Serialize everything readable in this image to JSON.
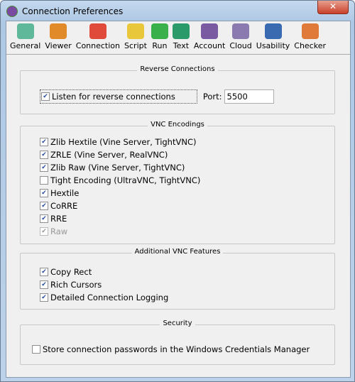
{
  "window": {
    "title": "Connection Preferences",
    "close_label": "✕"
  },
  "toolbar": [
    {
      "label": "General",
      "icon": "toolbox-icon",
      "color": "#5fb89a"
    },
    {
      "label": "Viewer",
      "icon": "glasses-icon",
      "color": "#e08a2a"
    },
    {
      "label": "Connection",
      "icon": "chain-link-icon",
      "color": "#e04a3a"
    },
    {
      "label": "Script",
      "icon": "pencil-gear-icon",
      "color": "#e8c83a"
    },
    {
      "label": "Run",
      "icon": "play-gear-icon",
      "color": "#3ab04a"
    },
    {
      "label": "Text",
      "icon": "magnifier-text-icon",
      "color": "#2a9a6a"
    },
    {
      "label": "Account",
      "icon": "user-gear-icon",
      "color": "#7a5aa0"
    },
    {
      "label": "Cloud",
      "icon": "cloud-icon",
      "color": "#8a7ab0"
    },
    {
      "label": "Usability",
      "icon": "eye-icon",
      "color": "#3a6ab0"
    },
    {
      "label": "Checker",
      "icon": "chart-magnifier-icon",
      "color": "#e07a3a"
    }
  ],
  "reverse": {
    "title": "Reverse Connections",
    "listen_label": "Listen for reverse connections",
    "listen_checked": true,
    "port_label": "Port:",
    "port_value": "5500"
  },
  "encodings": {
    "title": "VNC Encodings",
    "items": [
      {
        "label": "Zlib Hextile (Vine Server, TightVNC)",
        "checked": true
      },
      {
        "label": "ZRLE (Vine Server, RealVNC)",
        "checked": true
      },
      {
        "label": "Zlib Raw (Vine Server, TightVNC)",
        "checked": true
      },
      {
        "label": "Tight Encoding (UltraVNC, TightVNC)",
        "checked": false
      },
      {
        "label": "Hextile",
        "checked": true
      },
      {
        "label": "CoRRE",
        "checked": true
      },
      {
        "label": "RRE",
        "checked": true
      },
      {
        "label": "Raw",
        "checked": true,
        "disabled": true
      }
    ]
  },
  "features": {
    "title": "Additional VNC Features",
    "items": [
      {
        "label": "Copy Rect",
        "checked": true
      },
      {
        "label": "Rich Cursors",
        "checked": true
      },
      {
        "label": "Detailed Connection Logging",
        "checked": true
      }
    ]
  },
  "security": {
    "title": "Security",
    "items": [
      {
        "label": "Store connection passwords in the Windows Credentials Manager",
        "checked": false
      }
    ]
  }
}
